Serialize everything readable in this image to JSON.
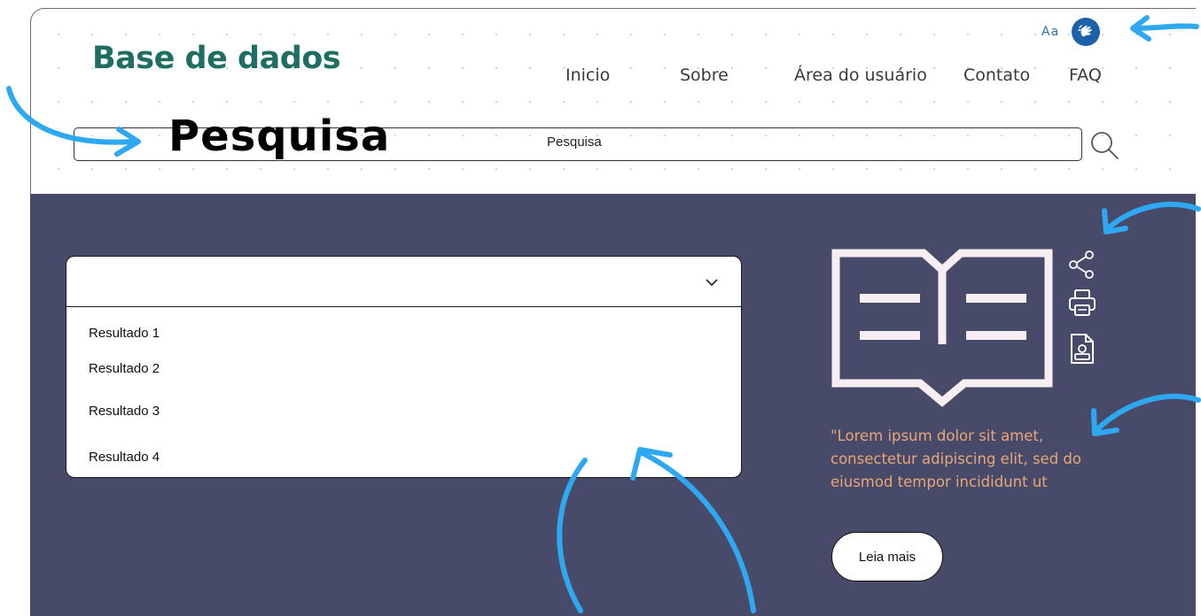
{
  "header": {
    "logo": "Base de dados",
    "accessibility": {
      "font_size_label": "Aa",
      "sign_language_icon": "sign-language-icon"
    },
    "nav": [
      {
        "label": "Inicio"
      },
      {
        "label": "Sobre"
      },
      {
        "label": "Área do usuário"
      },
      {
        "label": "Contato"
      },
      {
        "label": "FAQ"
      }
    ]
  },
  "search": {
    "big_label": "Pesquisa",
    "value": "Pesquisa",
    "icon": "search-icon"
  },
  "results": {
    "selected": "",
    "items": [
      {
        "label": "Resultado 1"
      },
      {
        "label": "Resultado 2"
      },
      {
        "label": "Resultado 3"
      },
      {
        "label": "Resultado 4"
      }
    ]
  },
  "feature": {
    "icons": [
      "book-icon",
      "share-icon",
      "print-icon",
      "document-icon"
    ],
    "quote": "\"Lorem ipsum dolor sit amet, consectetur adipiscing elit, sed do eiusmod tempor incididunt ut",
    "button_label": "Leia mais"
  },
  "colors": {
    "brand": "#1e6e62",
    "panel": "#474a69",
    "accent_link": "#2e6fb5",
    "quote": "#e8a679",
    "annotation_arrows": "#2ea8f0"
  }
}
